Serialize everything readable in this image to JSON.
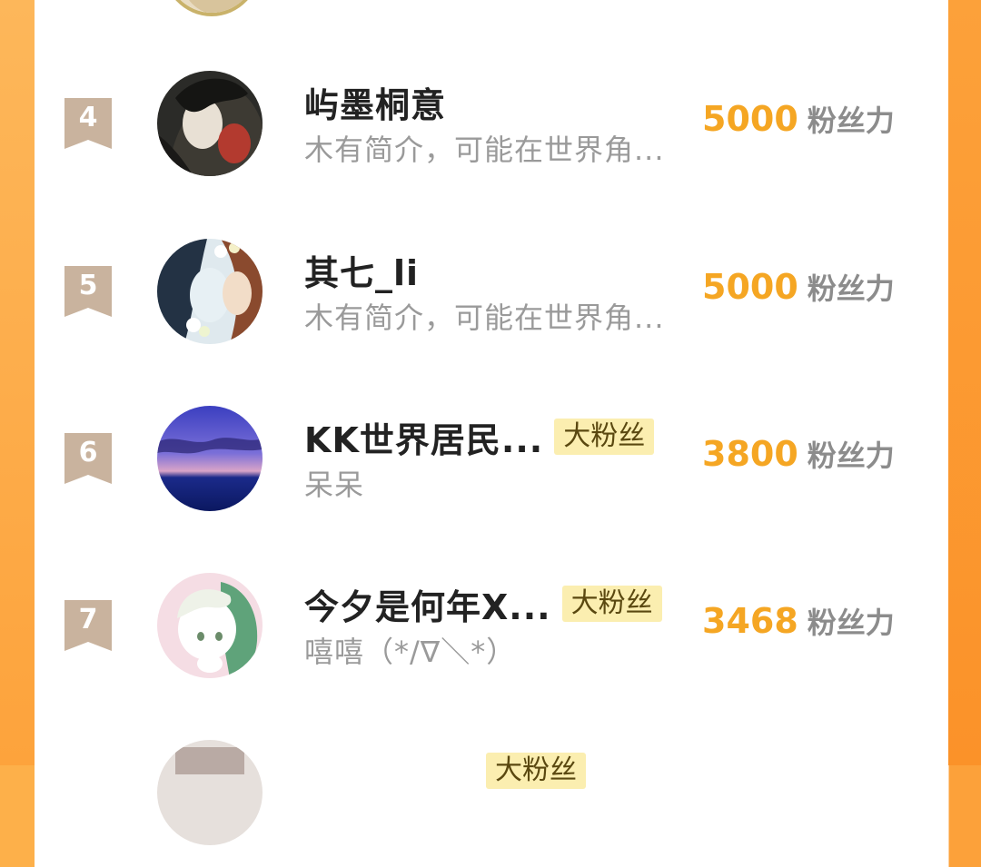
{
  "rows": [
    {
      "rank": "4",
      "name": "屿墨桐意",
      "badge": "",
      "bio": "木有简介，可能在世界角...",
      "score": "5000",
      "unit": "粉丝力"
    },
    {
      "rank": "5",
      "name": "其七_li",
      "badge": "",
      "bio": "木有简介，可能在世界角...",
      "score": "5000",
      "unit": "粉丝力"
    },
    {
      "rank": "6",
      "name": "KK世界居民...",
      "badge": "大粉丝",
      "bio": "呆呆",
      "score": "3800",
      "unit": "粉丝力"
    },
    {
      "rank": "7",
      "name": "今夕是何年X...",
      "badge": "大粉丝",
      "bio": "嘻嘻（*/∇＼*）",
      "score": "3468",
      "unit": "粉丝力"
    },
    {
      "rank": "",
      "name": "",
      "badge": "大粉丝",
      "bio": "",
      "score": "",
      "unit": ""
    }
  ],
  "colors": {
    "accent": "#f5a623",
    "rank_ribbon": "#c9b39e",
    "badge_bg": "#fbeeb0",
    "edge": "#fda33c"
  }
}
